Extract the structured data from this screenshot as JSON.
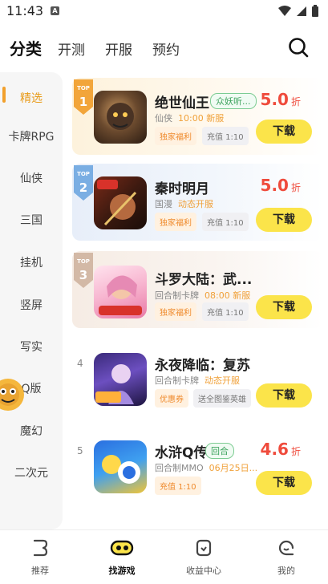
{
  "status": {
    "time": "11:43",
    "notif_label": "A"
  },
  "top_tabs": [
    {
      "label": "分类"
    },
    {
      "label": "开测"
    },
    {
      "label": "开服"
    },
    {
      "label": "预约"
    }
  ],
  "sidebar": {
    "items": [
      {
        "label": "精选"
      },
      {
        "label": "卡牌RPG"
      },
      {
        "label": "仙侠"
      },
      {
        "label": "三国"
      },
      {
        "label": "挂机"
      },
      {
        "label": "竖屏"
      },
      {
        "label": "写实"
      },
      {
        "label": "Q版"
      },
      {
        "label": "魔幻"
      },
      {
        "label": "二次元"
      }
    ]
  },
  "games": [
    {
      "rank": "1",
      "rank_badge": "TOP",
      "title": "绝世仙王",
      "tag": "众妖听...",
      "genre": "仙侠",
      "highlight": "10:00 新服",
      "chips": [
        "独家福利",
        "充值 1:10"
      ],
      "discount": "5.0",
      "discount_unit": "折",
      "button": "下载"
    },
    {
      "rank": "2",
      "rank_badge": "TOP",
      "title": "秦时明月",
      "tag": "",
      "genre": "国漫",
      "highlight": "动态开服",
      "chips": [
        "独家福利",
        "充值 1:10"
      ],
      "discount": "5.0",
      "discount_unit": "折",
      "button": "下载"
    },
    {
      "rank": "3",
      "rank_badge": "TOP",
      "title": "斗罗大陆：武...",
      "tag": "",
      "genre": "回合制卡牌",
      "highlight": "08:00 新服",
      "chips": [
        "独家福利",
        "充值 1:10"
      ],
      "discount": "",
      "discount_unit": "",
      "button": "下载"
    },
    {
      "rank": "4",
      "rank_badge": "",
      "title": "永夜降临：复苏",
      "tag": "",
      "genre": "回合制卡牌",
      "highlight": "动态开服",
      "chips": [
        "优惠券",
        "送全图鉴英雄"
      ],
      "discount": "",
      "discount_unit": "",
      "button": "下载"
    },
    {
      "rank": "5",
      "rank_badge": "",
      "title": "水浒Q传",
      "tag": "回合",
      "genre": "回合制MMO",
      "highlight": "06月25日...",
      "chips": [
        "充值 1:10"
      ],
      "discount": "4.6",
      "discount_unit": "折",
      "button": "下载"
    }
  ],
  "bottom_nav": [
    {
      "label": "推荐"
    },
    {
      "label": "找游戏"
    },
    {
      "label": "收益中心"
    },
    {
      "label": "我的"
    }
  ],
  "colors": {
    "accent": "#f2a02c",
    "button": "#fbe44a",
    "discount": "#ef4b3c"
  },
  "icons": {
    "search": "search-icon",
    "wifi": "wifi-icon",
    "signal": "signal-icon",
    "battery": "battery-icon",
    "nav": [
      "recommend-icon",
      "find-game-icon",
      "earnings-icon",
      "profile-icon"
    ]
  }
}
